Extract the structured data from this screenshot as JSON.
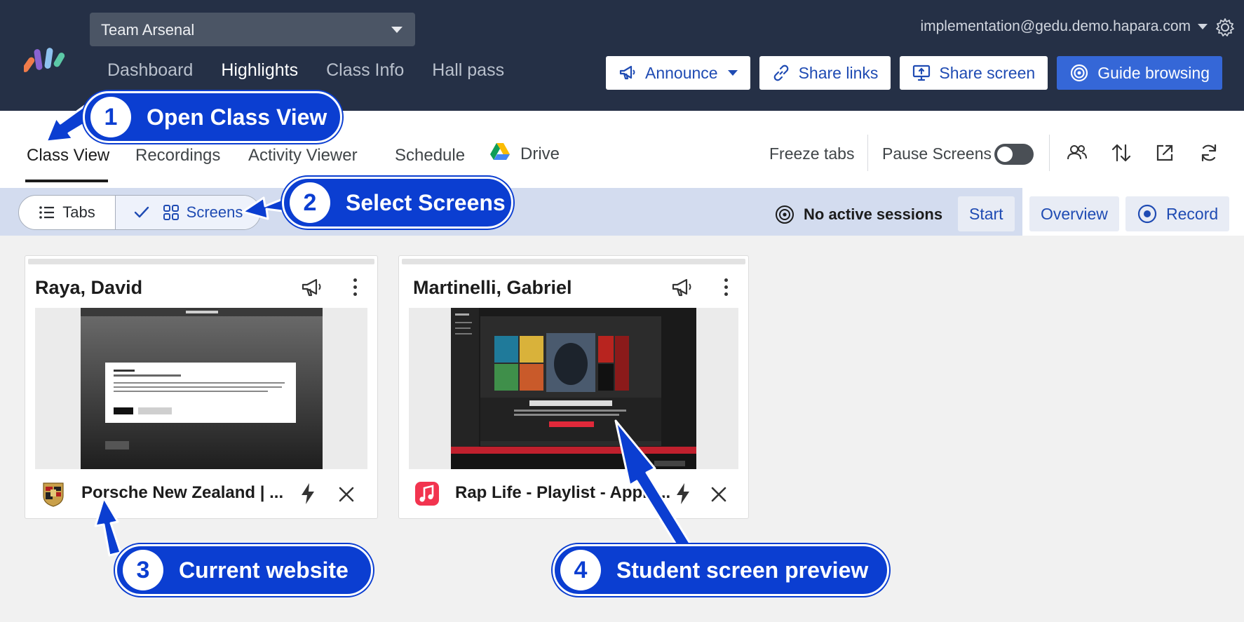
{
  "header": {
    "class_name": "Team Arsenal",
    "nav": [
      "Dashboard",
      "Highlights",
      "Class Info",
      "Hall pass"
    ],
    "active_nav": "Highlights",
    "account_email": "implementation@gedu.demo.hapara.com",
    "buttons": {
      "announce": "Announce",
      "share_links": "Share links",
      "share_screen": "Share screen",
      "guide_browsing": "Guide browsing"
    }
  },
  "subnav": {
    "tabs": [
      "Class View",
      "Recordings",
      "Activity Viewer",
      "Schedule",
      "Drive"
    ],
    "active_tab": "Class View",
    "freeze_tabs": "Freeze tabs",
    "pause_screens": "Pause Screens",
    "pause_screens_on": false
  },
  "session_bar": {
    "view_tabs": "Tabs",
    "view_screens": "Screens",
    "selected_view": "Screens",
    "status": "No active sessions",
    "start": "Start",
    "overview": "Overview",
    "record": "Record"
  },
  "students": [
    {
      "name": "Raya, David",
      "site": "Porsche New Zealand | ...",
      "favicon": "porsche-crest-icon"
    },
    {
      "name": "Martinelli, Gabriel",
      "site": "Rap Life - Playlist - Apple...",
      "favicon": "apple-music-icon"
    }
  ],
  "callouts": [
    {
      "number": "1",
      "label": "Open Class View"
    },
    {
      "number": "2",
      "label": "Select Screens"
    },
    {
      "number": "3",
      "label": "Current website"
    },
    {
      "number": "4",
      "label": "Student screen preview"
    }
  ],
  "colors": {
    "topbar": "#253046",
    "accent": "#3567d7",
    "link_blue": "#1f4bb3",
    "callout": "#0b3ed1",
    "session_bar": "#d3dcef"
  }
}
